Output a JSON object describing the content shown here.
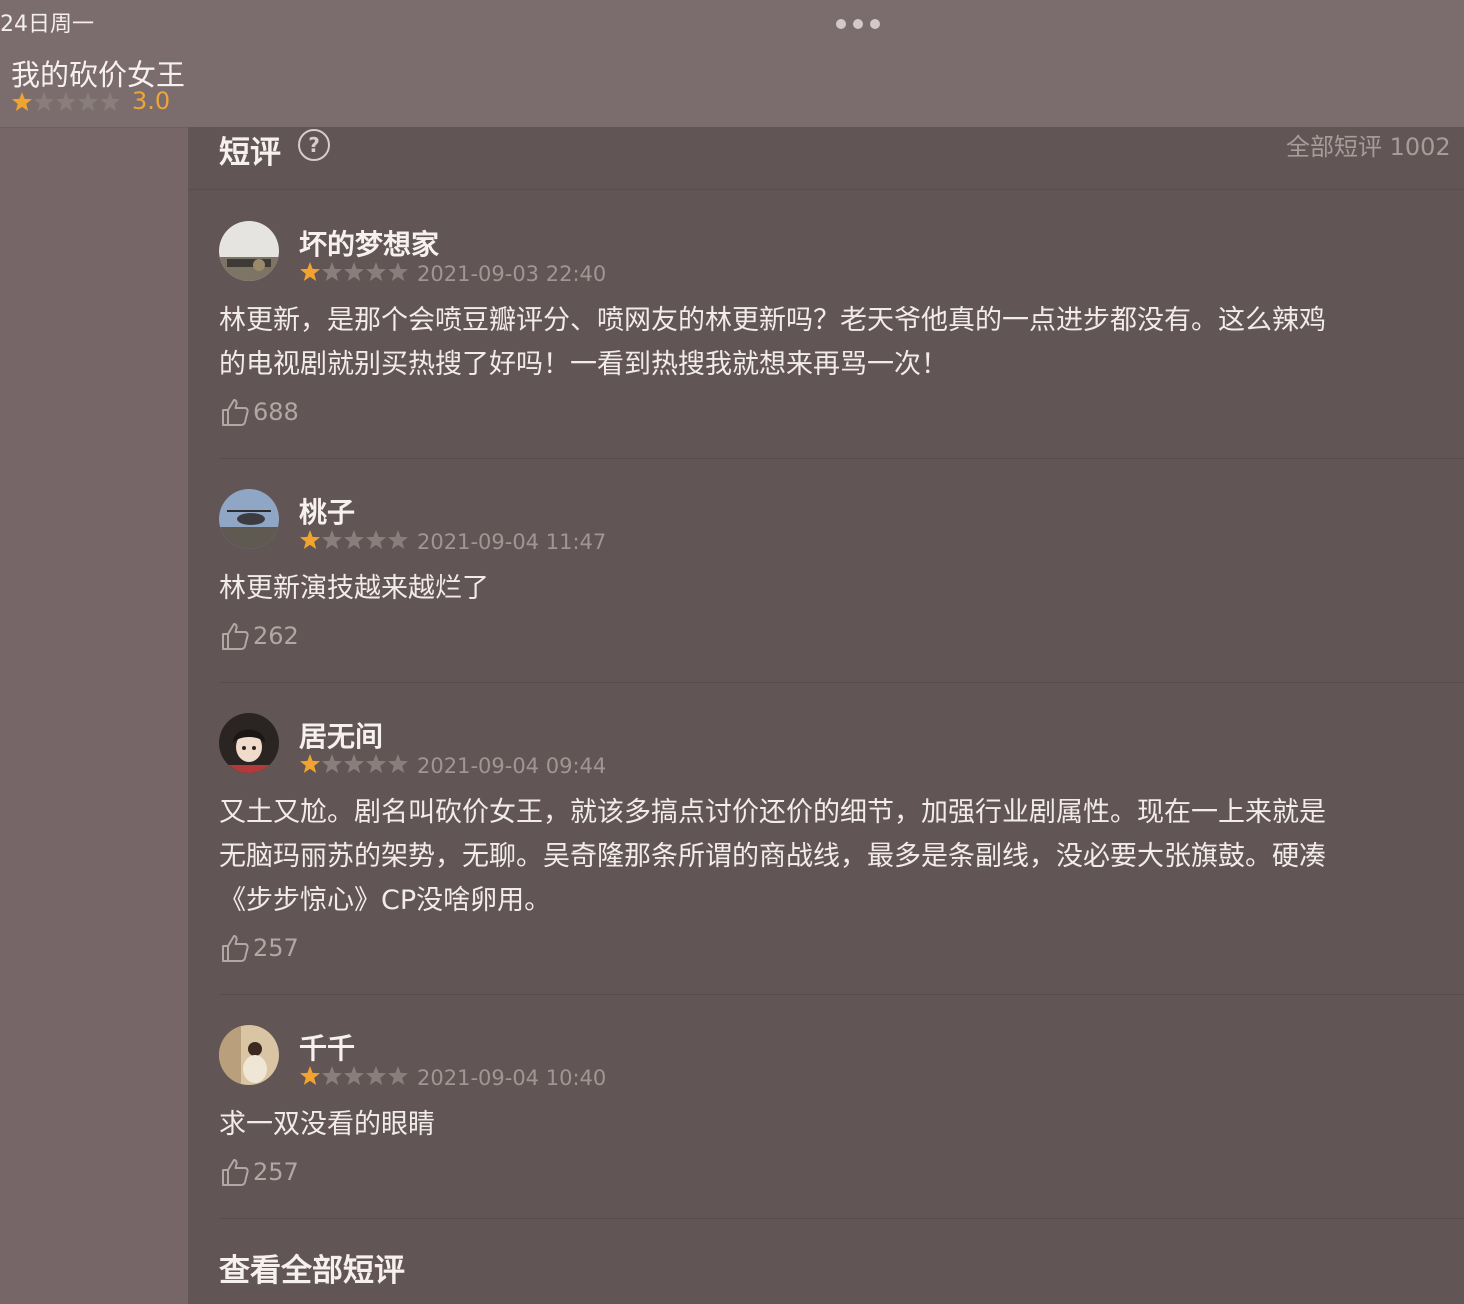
{
  "status": {
    "date": "24日周一"
  },
  "header": {
    "title": "我的砍价女王",
    "rating": "3.0",
    "stars_filled": 1.5
  },
  "section": {
    "title": "短评",
    "all_count": "全部短评 1002"
  },
  "reviews": [
    {
      "user": "坏的梦想家",
      "stars": 1,
      "date": "2021-09-03 22:40",
      "lines": [
        "林更新，是那个会喷豆瓣评分、喷网友的林更新吗？老天爷他真的一点进步都没有。这么辣鸡",
        "的电视剧就别买热搜了好吗！一看到热搜我就想来再骂一次！"
      ],
      "likes": "688"
    },
    {
      "user": "桃子",
      "stars": 1,
      "date": "2021-09-04 11:47",
      "lines": [
        "林更新演技越来越烂了"
      ],
      "likes": "262"
    },
    {
      "user": "居无间",
      "stars": 1,
      "date": "2021-09-04 09:44",
      "lines": [
        "又土又尬。剧名叫砍价女王，就该多搞点讨价还价的细节，加强行业剧属性。现在一上来就是",
        "无脑玛丽苏的架势，无聊。吴奇隆那条所谓的商战线，最多是条副线，没必要大张旗鼓。硬凑",
        "《步步惊心》CP没啥卵用。"
      ],
      "likes": "257"
    },
    {
      "user": "千千",
      "stars": 1,
      "date": "2021-09-04 10:40",
      "lines": [
        "求一双没看的眼睛"
      ],
      "likes": "257"
    }
  ],
  "footer": {
    "view_all": "查看全部短评"
  },
  "colors": {
    "star_active": "#f0a330",
    "star_inactive": "#8a7e7d"
  }
}
